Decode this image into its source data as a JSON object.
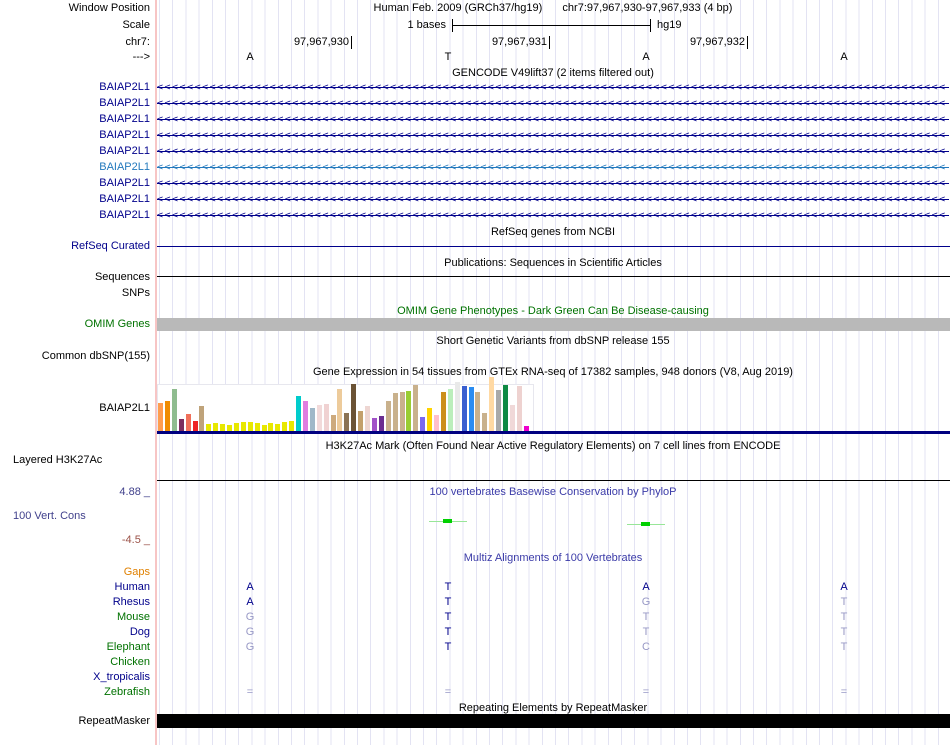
{
  "colors": {
    "navy": "#00008b",
    "gene_alt_blue": "#2379bd",
    "base_dark": "#00008b",
    "base_light": "#9899c6",
    "title_blue": "#3b3ba8",
    "label_green": "#007200",
    "gaps_orange": "#e08000",
    "conservation_green": "#00d000",
    "grid": "#e3e3f3"
  },
  "header": {
    "window_position_label": "Window Position",
    "assembly": "Human Feb. 2009 (GRCh37/hg19)",
    "range": "chr7:97,967,930-97,967,933 (4 bp)",
    "scale_label": "Scale",
    "scale_value": "1 bases",
    "scale_genome": "hg19",
    "chrom_label": "chr7:",
    "positions": [
      "97,967,930",
      "97,967,931",
      "97,967,932"
    ],
    "strand_label": "--->",
    "bases": [
      "A",
      "T",
      "A",
      "A"
    ]
  },
  "gencode": {
    "title": "GENCODE V49lift37 (2 items filtered out)",
    "arrow_char": "<",
    "arrow_count": 105,
    "genes": [
      {
        "label": "BAIAP2L1",
        "color": "#00008b"
      },
      {
        "label": "BAIAP2L1",
        "color": "#00008b"
      },
      {
        "label": "BAIAP2L1",
        "color": "#00008b"
      },
      {
        "label": "BAIAP2L1",
        "color": "#00008b"
      },
      {
        "label": "BAIAP2L1",
        "color": "#00008b"
      },
      {
        "label": "BAIAP2L1",
        "color": "#2379bd"
      },
      {
        "label": "BAIAP2L1",
        "color": "#00008b"
      },
      {
        "label": "BAIAP2L1",
        "color": "#00008b"
      },
      {
        "label": "BAIAP2L1",
        "color": "#00008b"
      }
    ]
  },
  "refseq": {
    "title": "RefSeq genes from NCBI",
    "label": "RefSeq Curated"
  },
  "publications": {
    "title": "Publications: Sequences in Scientific Articles",
    "sequences_label": "Sequences",
    "snps_label": "SNPs"
  },
  "omim": {
    "title": "OMIM Gene Phenotypes - Dark Green Can Be Disease-causing",
    "label": "OMIM Genes"
  },
  "dbsnp": {
    "title": "Short Genetic Variants from dbSNP release 155",
    "label": "Common dbSNP(155)"
  },
  "gtex": {
    "title": "Gene Expression in 54 tissues from GTEx RNA-seq of 17382 samples, 948 donors (V8, Aug 2019)",
    "label": "BAIAP2L1",
    "chart_data": {
      "type": "bar",
      "title": "Gene Expression in 54 tissues from GTEx RNA-seq of 17382 samples, 948 donors (V8, Aug 2019)",
      "note": "54 tissue bars, heights in px (relative expression), bar colors follow GTEx tissue palette",
      "bars": [
        [
          "#ff9d4e",
          28
        ],
        [
          "#f08c00",
          30
        ],
        [
          "#8fbc8f",
          42
        ],
        [
          "#7d2d5e",
          12
        ],
        [
          "#f0705a",
          17
        ],
        [
          "#ee2222",
          10
        ],
        [
          "#bfa37a",
          25
        ],
        [
          "#e8e800",
          7
        ],
        [
          "#e8e800",
          8
        ],
        [
          "#e8e800",
          7
        ],
        [
          "#e8e800",
          6
        ],
        [
          "#e8e800",
          8
        ],
        [
          "#e8e800",
          9
        ],
        [
          "#e8e800",
          9
        ],
        [
          "#e8e800",
          8
        ],
        [
          "#e8e800",
          6
        ],
        [
          "#e8e800",
          8
        ],
        [
          "#e8e800",
          7
        ],
        [
          "#e8e800",
          9
        ],
        [
          "#e8e800",
          10
        ],
        [
          "#00cccc",
          35
        ],
        [
          "#e07de0",
          30
        ],
        [
          "#9fb8c8",
          23
        ],
        [
          "#f2dada",
          26
        ],
        [
          "#f0d2d2",
          27
        ],
        [
          "#cdaa7d",
          16
        ],
        [
          "#edcb9b",
          42
        ],
        [
          "#8b7355",
          18
        ],
        [
          "#6b5335",
          47
        ],
        [
          "#c3a06c",
          20
        ],
        [
          "#eed6d2",
          25
        ],
        [
          "#a152c8",
          13
        ],
        [
          "#6a2d90",
          15
        ],
        [
          "#c9b18c",
          30
        ],
        [
          "#c9b18c",
          38
        ],
        [
          "#c9b18c",
          39
        ],
        [
          "#9acd32",
          40
        ],
        [
          "#c9b18c",
          46
        ],
        [
          "#7b68ee",
          14
        ],
        [
          "#ffd400",
          23
        ],
        [
          "#ffc0cb",
          16
        ],
        [
          "#cc8f1a",
          39
        ],
        [
          "#bbeebb",
          42
        ],
        [
          "#e9e9e9",
          49
        ],
        [
          "#3a5fd0",
          45
        ],
        [
          "#2a8cf2",
          44
        ],
        [
          "#c9b18c",
          39
        ],
        [
          "#c9b18c",
          18
        ],
        [
          "#ffd9a3",
          54
        ],
        [
          "#a9a9a9",
          41
        ],
        [
          "#0e8a44",
          46
        ],
        [
          "#f0d8d8",
          26
        ],
        [
          "#eed2d0",
          45
        ],
        [
          "#ee00cc",
          5
        ]
      ]
    }
  },
  "h3k27ac": {
    "title": "H3K27Ac Mark (Often Found Near Active Regulatory Elements) on 7 cell lines from ENCODE",
    "label": "Layered H3K27Ac"
  },
  "phylop": {
    "title": "100 vertebrates Basewise Conservation by PhyloP",
    "label": "100 Vert. Cons",
    "max_value": "4.88 _",
    "min_value": "-4.5 _"
  },
  "multiz": {
    "title": "Multiz Alignments of 100 Vertebrates",
    "rows": [
      {
        "label": "Gaps",
        "label_color": "#e08000",
        "bases": [
          "",
          "",
          "",
          ""
        ],
        "dim": [
          0,
          0,
          0,
          0
        ]
      },
      {
        "label": "Human",
        "label_color": "#00008b",
        "bases": [
          "A",
          "T",
          "A",
          "A"
        ],
        "dim": [
          0,
          0,
          0,
          0
        ]
      },
      {
        "label": "Rhesus",
        "label_color": "#00008b",
        "bases": [
          "A",
          "T",
          "G",
          "T"
        ],
        "dim": [
          0,
          0,
          1,
          1
        ]
      },
      {
        "label": "Mouse",
        "label_color": "#007200",
        "bases": [
          "G",
          "T",
          "T",
          "T"
        ],
        "dim": [
          1,
          0,
          1,
          1
        ]
      },
      {
        "label": "Dog",
        "label_color": "#00008b",
        "bases": [
          "G",
          "T",
          "T",
          "T"
        ],
        "dim": [
          1,
          0,
          1,
          1
        ]
      },
      {
        "label": "Elephant",
        "label_color": "#007200",
        "bases": [
          "G",
          "T",
          "C",
          "T"
        ],
        "dim": [
          1,
          0,
          1,
          1
        ]
      },
      {
        "label": "Chicken",
        "label_color": "#007200",
        "bases": [
          "",
          "",
          "",
          ""
        ],
        "dim": [
          0,
          0,
          0,
          0
        ]
      },
      {
        "label": "X_tropicalis",
        "label_color": "#00008b",
        "bases": [
          "",
          "",
          "",
          ""
        ],
        "dim": [
          0,
          0,
          0,
          0
        ]
      },
      {
        "label": "Zebrafish",
        "label_color": "#007200",
        "bases": [
          "=",
          "=",
          "=",
          "="
        ],
        "dim": [
          1,
          1,
          1,
          1
        ]
      }
    ]
  },
  "repeatmasker": {
    "title": "Repeating Elements by RepeatMasker",
    "label": "RepeatMasker"
  }
}
